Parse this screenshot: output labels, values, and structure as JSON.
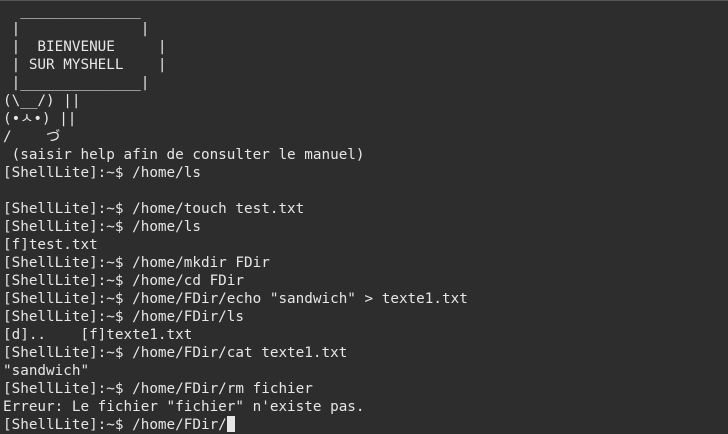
{
  "terminal": {
    "colors": {
      "background": "#2d2d2d",
      "foreground": "#e6e6e6"
    },
    "lines": [
      "  ______________",
      " |              |",
      " |  BIENVENUE     |",
      " | SUR MYSHELL    |",
      " |______________|",
      "(\\__/) ||",
      "(•ㅅ•) ||",
      "/    づ",
      " (saisir help afin de consulter le manuel)",
      "[ShellLite]:~$ /home/ls",
      "",
      "[ShellLite]:~$ /home/touch test.txt",
      "[ShellLite]:~$ /home/ls",
      "[f]test.txt",
      "[ShellLite]:~$ /home/mkdir FDir",
      "[ShellLite]:~$ /home/cd FDir",
      "[ShellLite]:~$ /home/FDir/echo \"sandwich\" > texte1.txt",
      "[ShellLite]:~$ /home/FDir/ls",
      "[d]..    [f]texte1.txt",
      "[ShellLite]:~$ /home/FDir/cat texte1.txt",
      "\"sandwich\"",
      "[ShellLite]:~$ /home/FDir/rm fichier",
      "Erreur: Le fichier \"fichier\" n'existe pas."
    ],
    "prompt_line": "[ShellLite]:~$ /home/FDir/"
  }
}
